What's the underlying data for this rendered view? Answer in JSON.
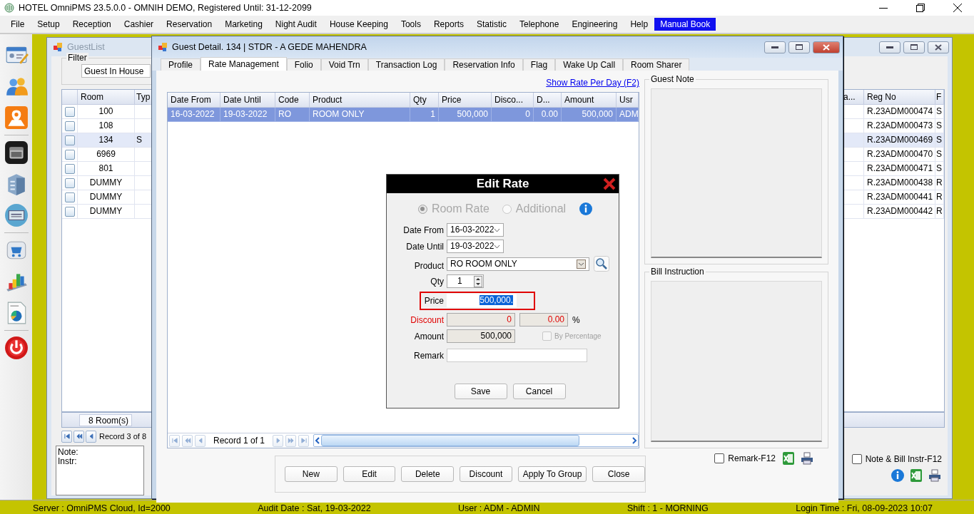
{
  "window": {
    "title": "HOTEL OmniPMS 23.5.0.0 - OMNIH DEMO, Registered Until: 31-12-2099"
  },
  "menu": [
    {
      "label": "File",
      "selected": false
    },
    {
      "label": "Setup",
      "selected": false
    },
    {
      "label": "Reception",
      "selected": false
    },
    {
      "label": "Cashier",
      "selected": false
    },
    {
      "label": "Reservation",
      "selected": false
    },
    {
      "label": "Marketing",
      "selected": false
    },
    {
      "label": "Night Audit",
      "selected": false
    },
    {
      "label": "House Keeping",
      "selected": false
    },
    {
      "label": "Tools",
      "selected": false
    },
    {
      "label": "Reports",
      "selected": false
    },
    {
      "label": "Statistic",
      "selected": false
    },
    {
      "label": "Telephone",
      "selected": false
    },
    {
      "label": "Engineering",
      "selected": false
    },
    {
      "label": "Help",
      "selected": false
    },
    {
      "label": "Manual Book",
      "selected": true
    }
  ],
  "guest_list": {
    "title": "GuestList",
    "filter_label": "Filter",
    "filter_value": "Guest In House",
    "columns_left": [
      "Room",
      "Typ"
    ],
    "columns_right": [
      "a...",
      "Reg No",
      "F"
    ],
    "rows": [
      {
        "room": "100",
        "type": "",
        "reg_no": "R.23ADM000474",
        "column_last": "S",
        "checked": false,
        "selected": false
      },
      {
        "room": "108",
        "type": "",
        "reg_no": "R.23ADM000473",
        "column_last": "S",
        "checked": false,
        "selected": false
      },
      {
        "room": "134",
        "type": "S",
        "reg_no": "R.23ADM000469",
        "column_last": "S",
        "checked": false,
        "selected": true
      },
      {
        "room": "6969",
        "type": "",
        "reg_no": "R.23ADM000470",
        "column_last": "S",
        "checked": false,
        "selected": false
      },
      {
        "room": "801",
        "type": "",
        "reg_no": "R.23ADM000471",
        "column_last": "S",
        "checked": false,
        "selected": false
      },
      {
        "room": "DUMMY",
        "type": "",
        "reg_no": "R.23ADM000438",
        "column_last": "R",
        "checked": false,
        "selected": false
      },
      {
        "room": "DUMMY",
        "type": "",
        "reg_no": "R.23ADM000441",
        "column_last": "R",
        "checked": false,
        "selected": false
      },
      {
        "room": "DUMMY",
        "type": "",
        "reg_no": "R.23ADM000442",
        "column_last": "R",
        "checked": false,
        "selected": false
      }
    ],
    "room_count": "8 Room(s)",
    "record": "Record 3 of 8",
    "note_lines": [
      "Note:",
      "Instr:"
    ],
    "note_bill_check": {
      "label": "Note & Bill Instr-F12",
      "checked": false
    }
  },
  "guest_detail": {
    "title": "Guest Detail. 134 | STDR - A GEDE MAHENDRA",
    "tabs": [
      {
        "label": "Profile",
        "selected": false
      },
      {
        "label": "Rate Management",
        "selected": true
      },
      {
        "label": "Folio",
        "selected": false
      },
      {
        "label": "Void Trn",
        "selected": false
      },
      {
        "label": "Transaction Log",
        "selected": false
      },
      {
        "label": "Reservation Info",
        "selected": false
      },
      {
        "label": "Flag",
        "selected": false
      },
      {
        "label": "Wake Up Call",
        "selected": false
      },
      {
        "label": "Room Sharer",
        "selected": false
      }
    ],
    "link": "Show Rate Per Day (F2)",
    "columns": [
      "Date From",
      "Date Until",
      "Code",
      "Product",
      "Qty",
      "Price",
      "Disco...",
      "D...",
      "Amount",
      "Usr"
    ],
    "rows": [
      {
        "cells": [
          "16-03-2022",
          "19-03-2022",
          "RO",
          "ROOM ONLY",
          "1",
          "500,000",
          "0",
          "0.00",
          "500,000",
          "ADM"
        ],
        "selected": true
      }
    ],
    "record": "Record 1 of 1",
    "buttons": [
      "New",
      "Edit",
      "Delete",
      "Discount",
      "Apply To Group",
      "Close"
    ],
    "guest_note_label": "Guest Note",
    "bill_instruction_label": "Bill Instruction",
    "remark_check": {
      "label": "Remark-F12",
      "checked": false
    }
  },
  "edit_rate": {
    "title": "Edit Rate",
    "rate_types": [
      {
        "label": "Room Rate",
        "selected": true
      },
      {
        "label": "Additional",
        "selected": false
      }
    ],
    "date_from": {
      "label": "Date From",
      "value": "16-03-2022"
    },
    "date_until": {
      "label": "Date Until",
      "value": "19-03-2022"
    },
    "product": {
      "label": "Product",
      "value": "RO ROOM ONLY"
    },
    "qty": {
      "label": "Qty",
      "value": "1"
    },
    "price": {
      "label": "Price",
      "value": "500,000."
    },
    "discount": {
      "label": "Discount",
      "value": "0",
      "percent": "0.00",
      "percent_sign": "%"
    },
    "amount": {
      "label": "Amount",
      "value": "500,000"
    },
    "by_percentage": {
      "label": "By Percentage",
      "checked": false
    },
    "remark": {
      "label": "Remark"
    },
    "buttons": [
      "Save",
      "Cancel"
    ]
  },
  "status_bar": [
    "Server : OmniPMS Cloud, Id=2000",
    "Audit Date : Sat, 19-03-2022",
    "User : ADM - ADMIN",
    "Shift : 1 - MORNING",
    "Login Time : Fri, 08-09-2023 10:07"
  ]
}
